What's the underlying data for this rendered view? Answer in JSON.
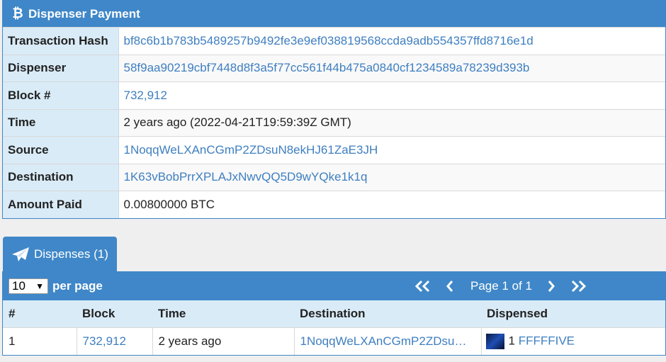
{
  "panel": {
    "title": "Dispenser Payment",
    "rows": [
      {
        "label": "Transaction Hash",
        "value": "bf8c6b1b783b5489257b9492fe3e9ef038819568ccda9adb554357ffd8716e1d",
        "link": true
      },
      {
        "label": "Dispenser",
        "value": "58f9aa90219cbf7448d8f3a5f77cc561f44b475a0840cf1234589a78239d393b",
        "link": true
      },
      {
        "label": "Block #",
        "value": "732,912",
        "link": true
      },
      {
        "label": "Time",
        "value": "2 years ago (2022-04-21T19:59:39Z GMT)",
        "link": false
      },
      {
        "label": "Source",
        "value": "1NoqqWeLXAnCGmP2ZDsuN8ekHJ61ZaE3JH",
        "link": true
      },
      {
        "label": "Destination",
        "value": "1K63vBobPrrXPLAJxNwvQQ5D9wYQke1k1q",
        "link": true
      },
      {
        "label": "Amount Paid",
        "value": "0.00800000 BTC",
        "link": false
      }
    ]
  },
  "tab": {
    "label": "Dispenses (1)"
  },
  "toolbar": {
    "per_page_value": "10",
    "per_page_label": "per page",
    "page_text": "Page 1 of 1"
  },
  "list": {
    "columns": [
      "#",
      "Block",
      "Time",
      "Destination",
      "Dispensed"
    ],
    "rows": [
      {
        "num": "1",
        "block": "732,912",
        "time": "2 years ago",
        "destination": "1NoqqWeLXAnCGmP2ZDsu…",
        "qty": "1",
        "asset": "FFFFFIVE"
      }
    ]
  },
  "colors": {
    "accent": "#3f87c8",
    "header_cell": "#d9ebf7",
    "link": "#3f7fc0"
  }
}
